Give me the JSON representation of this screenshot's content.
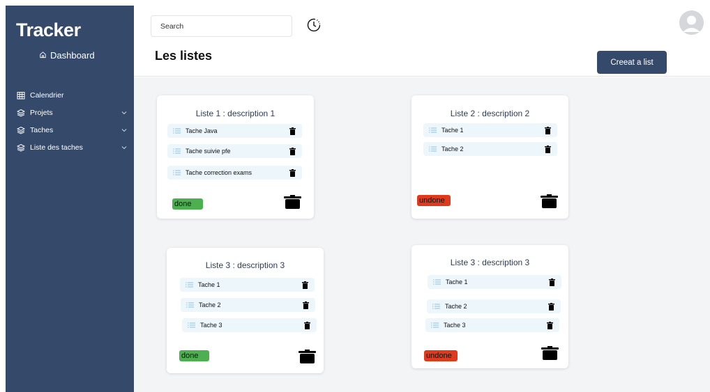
{
  "brand": "Tracker",
  "sidebar": {
    "dashboard": "Dashboard",
    "items": [
      {
        "label": "Calendrier"
      },
      {
        "label": "Projets"
      },
      {
        "label": "Taches"
      },
      {
        "label": "Liste des taches"
      }
    ]
  },
  "header": {
    "search_placeholder": "Search",
    "title": "Les listes",
    "create_label": "Creeat a list"
  },
  "lists": [
    {
      "title": "Liste 1 : description 1",
      "tasks": [
        "Tache Java",
        "Tache suivie pfe",
        "Tache correction exams"
      ],
      "status": "done"
    },
    {
      "title": "Liste 2 : description 2",
      "tasks": [
        "Tache 1",
        "Tache 2"
      ],
      "status": "undone"
    },
    {
      "title": "Liste 3 : description 3",
      "tasks": [
        "Tache 1",
        "Tache 2",
        "Tache 3"
      ],
      "status": "done"
    },
    {
      "title": "Liste 3 : description 3",
      "tasks": [
        "Tache 1",
        "Tache 2",
        "Tache 3"
      ],
      "status": "undone"
    }
  ],
  "colors": {
    "sidebar": "#354a6b",
    "done": "#4caf50",
    "undone": "#e03a1c",
    "task_bg": "#edf6fb"
  },
  "icons": [
    "home-icon",
    "calendar-icon",
    "layers-icon",
    "chevron-down-icon",
    "clock-icon",
    "user-avatar-icon",
    "list-icon",
    "trash-icon",
    "pot-icon"
  ]
}
